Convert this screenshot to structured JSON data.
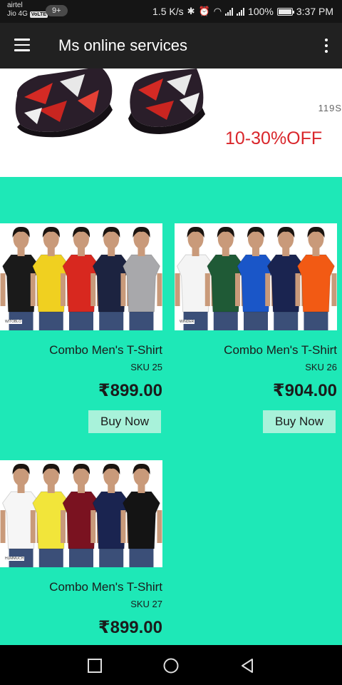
{
  "status_bar": {
    "carrier_name": "airtel",
    "network_line": "Jio 4G",
    "volte_label": "VoLTE",
    "notification_count": "9+",
    "net_speed": "1.5 K/s",
    "battery_percent": "100%",
    "time": "3:37 PM"
  },
  "app_bar": {
    "title": "Ms online services"
  },
  "banner": {
    "code": "119S",
    "offer": "10-30%OFF"
  },
  "products": [
    {
      "brand": "WITOBLO",
      "name": "Combo Men's T-Shirt",
      "sku": "SKU 25",
      "price": "₹899.00",
      "button": "Buy Now",
      "shirt_colors": [
        "#1a1a1a",
        "#f0d020",
        "#d8281f",
        "#1c2340",
        "#a8a8ab"
      ]
    },
    {
      "brand": "WINDER",
      "name": "Combo Men's T-Shirt",
      "sku": "SKU 26",
      "price": "₹904.00",
      "button": "Buy Now",
      "shirt_colors": [
        "#f4f4f4",
        "#1f5a36",
        "#1a56c8",
        "#1a2450",
        "#f25a14"
      ]
    },
    {
      "brand": "HUMMUCH",
      "name": "Combo Men's T-Shirt",
      "sku": "SKU 27",
      "price": "₹899.00",
      "shirt_colors": [
        "#f6f6f6",
        "#f2e53a",
        "#7a1220",
        "#1a2450",
        "#141414"
      ]
    }
  ],
  "colors": {
    "background": "#1ee8b7",
    "app_bar": "#212121",
    "button": "#a8f2da",
    "offer": "#d9262b"
  }
}
